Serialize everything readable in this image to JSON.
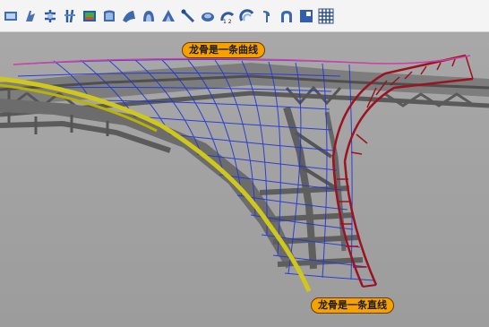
{
  "toolbar": {
    "tools": [
      "surface-from-curves-icon",
      "extrude-icon",
      "revolve-icon",
      "rail-revolve-icon",
      "sweep-icon",
      "loft-icon",
      "network-surface-icon",
      "patch-icon",
      "edge-surface-icon",
      "corner-surface-icon",
      "blend-icon",
      "offset-surface-icon",
      "fillet-surface-icon",
      "cap-icon",
      "unroll-icon",
      "drape-icon",
      "grid-icon"
    ],
    "rail_label": "1 2"
  },
  "callouts": {
    "top": "龙骨是一条曲线",
    "bottom": "龙骨是一条直线"
  },
  "colors": {
    "toolbar_bg": "#f4f4f4",
    "viewport_bg": "#a3a3a3",
    "callout_bg": "#f5a100",
    "yellow_rail": "#cfc71a",
    "grid_blue": "#1a2bd6",
    "frame_red": "#a01622",
    "structure_gray": "#6e6e6e"
  }
}
